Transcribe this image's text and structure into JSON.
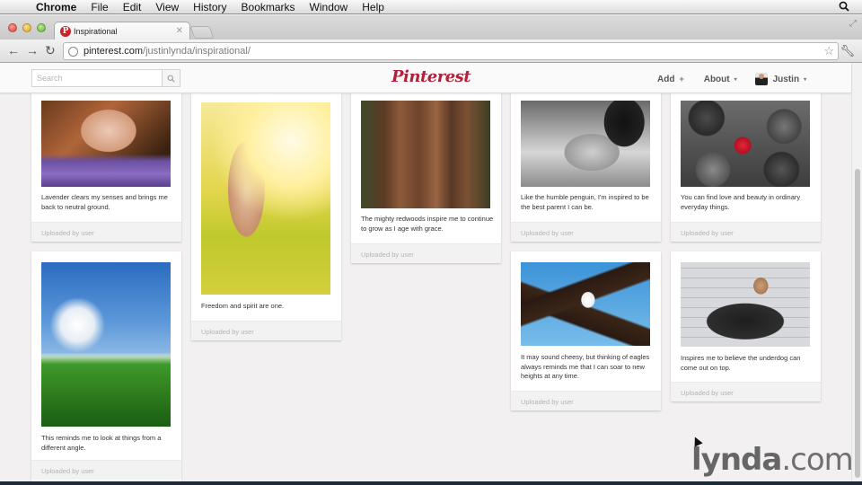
{
  "menubar": {
    "app": "Chrome",
    "items": [
      "File",
      "Edit",
      "View",
      "History",
      "Bookmarks",
      "Window",
      "Help"
    ]
  },
  "browser": {
    "tab_title": "Inspirational",
    "url_host": "pinterest.com",
    "url_path": "/justinlynda/inspirational/"
  },
  "header": {
    "search_placeholder": "Search",
    "logo": "Pinterest",
    "logo_color": "#b3203a",
    "nav": [
      {
        "label": "Add",
        "indicator": "+"
      },
      {
        "label": "About",
        "indicator": "▾"
      }
    ],
    "user": {
      "name": "Justin",
      "indicator": "▾"
    }
  },
  "pins": [
    {
      "id": "lavender",
      "caption": "Lavender clears my senses and brings me back to neutral ground.",
      "footer": "Uploaded by user"
    },
    {
      "id": "freedom",
      "caption": "Freedom and spirit are one.",
      "footer": "Uploaded by user"
    },
    {
      "id": "redwood",
      "caption": "The mighty redwoods inspire me to continue to grow as I age with grace.",
      "footer": "Uploaded by user"
    },
    {
      "id": "penguin",
      "caption": "Like the humble penguin, I'm inspired to be the best parent I can be.",
      "footer": "Uploaded by user"
    },
    {
      "id": "stones",
      "caption": "You can find love and beauty in ordinary everyday things.",
      "footer": "Uploaded by user"
    },
    {
      "id": "dandelion",
      "caption": "This reminds me to look at things from a different angle.",
      "footer": "Uploaded by user"
    },
    {
      "id": "eagle",
      "caption": "It may sound cheesy, but thinking of eagles always reminds me that I can soar to new heights at any time.",
      "footer": "Uploaded by user"
    },
    {
      "id": "dog",
      "caption": "Inspires me to believe the underdog can come out on top.",
      "footer": "Uploaded by user"
    }
  ],
  "watermark": {
    "brand": "lynda",
    "suffix": ".com"
  }
}
